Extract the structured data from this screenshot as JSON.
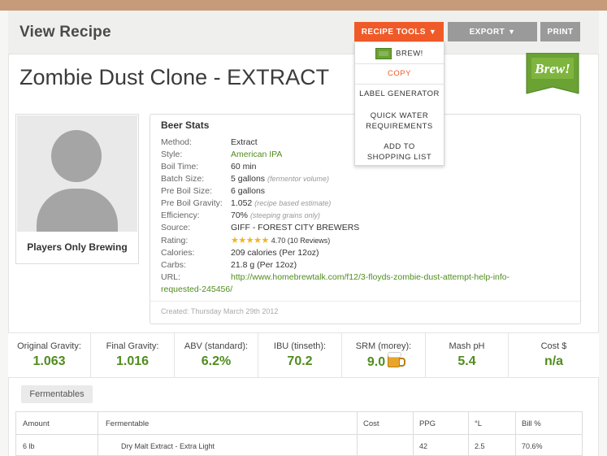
{
  "header": {
    "title": "View Recipe",
    "buttons": {
      "recipe_tools": "RECIPE TOOLS",
      "export": "EXPORT",
      "print": "PRINT"
    }
  },
  "dropdown": {
    "items": [
      "BREW!",
      "COPY",
      "LABEL GENERATOR",
      "QUICK WATER",
      "REQUIREMENTS",
      "ADD TO",
      "SHOPPING LIST"
    ]
  },
  "recipe": {
    "title": "Zombie Dust Clone - EXTRACT",
    "badge": "Brew!",
    "brewer": "Players Only Brewing"
  },
  "beer_stats": {
    "title": "Beer Stats",
    "labels": [
      "Method:",
      "Style:",
      "Boil Time:",
      "Batch Size:",
      "Pre Boil Size:",
      "Pre Boil Gravity:",
      "Efficiency:",
      "Source:",
      "Rating:",
      "Calories:",
      "Carbs:",
      "URL:"
    ],
    "method": "Extract",
    "style": "American IPA",
    "boil_time": "60 min",
    "batch_size": "5 gallons",
    "batch_note": "(fermentor volume)",
    "pre_boil_size": "6 gallons",
    "pre_boil_gravity": "1.052",
    "gravity_note": "(recipe based estimate)",
    "efficiency": "70%",
    "efficiency_note": "(steeping grains only)",
    "source": "GIFF - FOREST CITY BREWERS",
    "rating_stars": "★★★★★",
    "rating": "4.70 (10 Reviews)",
    "calories": "209 calories (Per 12oz)",
    "carbs": "21.8 g (Per 12oz)",
    "url_line1": "http://www.homebrewtalk.com/f12/3-floyds-zombie-dust-attempt-help-info-",
    "url_line2": "requested-245456/",
    "created": "Created: Thursday March 29th 2012"
  },
  "metrics": [
    {
      "label": "Original Gravity:",
      "value": "1.063"
    },
    {
      "label": "Final Gravity:",
      "value": "1.016"
    },
    {
      "label": "ABV (standard):",
      "value": "6.2%"
    },
    {
      "label": "IBU (tinseth):",
      "value": "70.2"
    },
    {
      "label": "SRM (morey):",
      "value": "9.0"
    },
    {
      "label": "Mash pH",
      "value": "5.4"
    },
    {
      "label": "Cost $",
      "value": "n/a"
    }
  ],
  "fermentables": {
    "tab": "Fermentables",
    "headers": [
      "Amount",
      "Fermentable",
      "Cost",
      "PPG",
      "°L",
      "Bill %"
    ],
    "rows": [
      {
        "amount": "6 lb",
        "name": "Dry Malt Extract - Extra Light",
        "cost": "",
        "ppg": "42",
        "lovibond": "2.5",
        "bill": "70.6%"
      }
    ]
  },
  "colors": {
    "accent": "#f05a28",
    "green": "#4f8d1e",
    "button_gray": "#9a9a9a"
  }
}
